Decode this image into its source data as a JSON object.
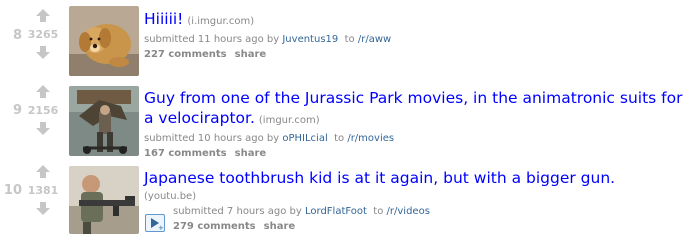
{
  "posts": [
    {
      "rank": "8",
      "score": "3265",
      "title": "Hiiiii!",
      "domain": "(i.imgur.com)",
      "submitted_prefix": "submitted 11 hours ago by",
      "author": "Juventus19",
      "to_prefix": "to",
      "subreddit": "/r/aww",
      "comments": "227 comments",
      "share": "share",
      "thumb_icon": "golden-retriever-puppy"
    },
    {
      "rank": "9",
      "score": "2156",
      "title": "Guy from one of the Jurassic Park movies, in the animatronic suits for a velociraptor.",
      "domain": "(imgur.com)",
      "submitted_prefix": "submitted 10 hours ago by",
      "author": "oPHILcial",
      "to_prefix": "to",
      "subreddit": "/r/movies",
      "comments": "167 comments",
      "share": "share",
      "thumb_icon": "man-in-velociraptor-rig"
    },
    {
      "rank": "10",
      "score": "1381",
      "title": "Japanese toothbrush kid is at it again, but with a bigger gun.",
      "domain": "(youtu.be)",
      "submitted_prefix": "submitted 7 hours ago by",
      "author": "LordFlatFoot",
      "to_prefix": "to",
      "subreddit": "/r/videos",
      "comments": "279 comments",
      "share": "share",
      "thumb_icon": "man-holding-rifle",
      "expando_icon": "video-play-expando"
    }
  ],
  "colors": {
    "title_link": "#0000ff",
    "meta_link": "#336699",
    "muted": "#888888",
    "score": "#c6c6c6",
    "arrow": "#c6c6c6"
  }
}
